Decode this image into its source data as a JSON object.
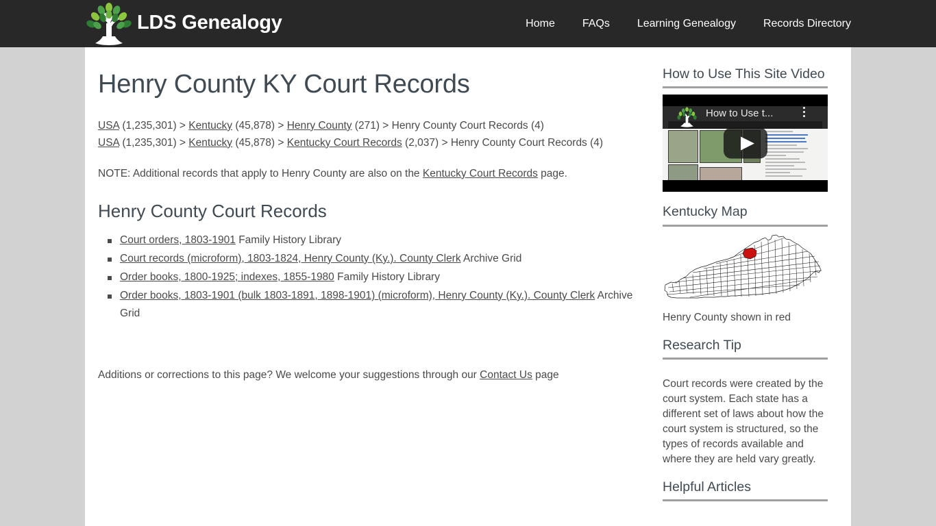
{
  "site": {
    "brand_name": "LDS Genealogy",
    "logo_icon": "tree-logo-icon"
  },
  "nav": {
    "items": [
      {
        "label": "Home"
      },
      {
        "label": "FAQs"
      },
      {
        "label": "Learning Genealogy"
      },
      {
        "label": "Records Directory"
      }
    ]
  },
  "main": {
    "page_title": "Henry County KY Court Records",
    "breadcrumbs": [
      {
        "parts": [
          {
            "text": "USA",
            "link": true
          },
          {
            "text": " (1,235,301) > ",
            "link": false
          },
          {
            "text": "Kentucky",
            "link": true
          },
          {
            "text": " (45,878) > ",
            "link": false
          },
          {
            "text": "Henry County",
            "link": true
          },
          {
            "text": " (271) > Henry County Court Records (4)",
            "link": false
          }
        ]
      },
      {
        "parts": [
          {
            "text": "USA",
            "link": true
          },
          {
            "text": " (1,235,301) > ",
            "link": false
          },
          {
            "text": "Kentucky",
            "link": true
          },
          {
            "text": " (45,878) > ",
            "link": false
          },
          {
            "text": "Kentucky Court Records",
            "link": true
          },
          {
            "text": " (2,037) > Henry County Court Records (4)",
            "link": false
          }
        ]
      }
    ],
    "note": {
      "before": "NOTE: Additional records that apply to Henry County are also on the ",
      "link": "Kentucky Court Records",
      "after": " page."
    },
    "section_title": "Henry County Court Records",
    "records": [
      {
        "link": "Court orders, 1803-1901",
        "source": " Family History Library"
      },
      {
        "link": "Court records (microform), 1803-1824, Henry County (Ky.). County Clerk",
        "source": " Archive Grid"
      },
      {
        "link": "Order books, 1800-1925; indexes, 1855-1980",
        "source": " Family History Library"
      },
      {
        "link": "Order books, 1803-1901 (bulk 1803-1891, 1898-1901) (microform), Henry County (Ky.). County Clerk",
        "source": " Archive Grid"
      }
    ],
    "footer_note": {
      "before": "Additions or corrections to this page? We welcome your suggestions through our ",
      "link": "Contact Us",
      "after": " page"
    }
  },
  "sidebar": {
    "video_widget": {
      "heading": "How to Use This Site Video",
      "player_title": "How to Use t...",
      "play_icon": "play-button-icon",
      "menu_icon": "youtube-more-icon"
    },
    "map_widget": {
      "heading": "Kentucky Map",
      "caption": "Henry County shown in red",
      "highlight_color": "#cc1111"
    },
    "tip_widget": {
      "heading": "Research Tip",
      "text": "Court records were created by the court system. Each state has a different set of laws about how the court system is structured, so the types of records available and where they are held vary greatly."
    },
    "articles_widget": {
      "heading": "Helpful Articles"
    }
  },
  "theme": {
    "header_bg": "#282828",
    "page_bg": "#d2d2d2",
    "content_bg": "#ffffff",
    "text_color": "#4a4a4a",
    "heading_color": "#3f4a52",
    "rule_color": "#a0a0a0"
  }
}
